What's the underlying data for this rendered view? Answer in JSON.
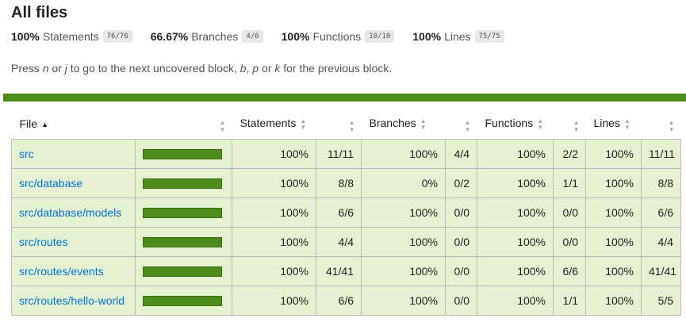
{
  "page": {
    "title": "All files",
    "hint_parts": [
      "Press ",
      "n",
      " or ",
      "j",
      " to go to the next uncovered block, ",
      "b",
      ", ",
      "p",
      " or ",
      "k",
      " for the previous block."
    ]
  },
  "summary": [
    {
      "pct": "100%",
      "label": "Statements",
      "fraction": "76/76"
    },
    {
      "pct": "66.67%",
      "label": "Branches",
      "fraction": "4/6"
    },
    {
      "pct": "100%",
      "label": "Functions",
      "fraction": "10/10"
    },
    {
      "pct": "100%",
      "label": "Lines",
      "fraction": "75/75"
    }
  ],
  "table": {
    "headers": {
      "file": "File",
      "statements": "Statements",
      "branches": "Branches",
      "functions": "Functions",
      "lines": "Lines"
    },
    "rows": [
      {
        "file": "src",
        "coverage": 1.0,
        "stmt_pct": "100%",
        "stmt_frac": "11/11",
        "br_pct": "100%",
        "br_frac": "4/4",
        "br_low": false,
        "fn_pct": "100%",
        "fn_frac": "2/2",
        "ln_pct": "100%",
        "ln_frac": "11/11"
      },
      {
        "file": "src/database",
        "coverage": 1.0,
        "stmt_pct": "100%",
        "stmt_frac": "8/8",
        "br_pct": "0%",
        "br_frac": "0/2",
        "br_low": true,
        "fn_pct": "100%",
        "fn_frac": "1/1",
        "ln_pct": "100%",
        "ln_frac": "8/8"
      },
      {
        "file": "src/database/models",
        "coverage": 1.0,
        "stmt_pct": "100%",
        "stmt_frac": "6/6",
        "br_pct": "100%",
        "br_frac": "0/0",
        "br_low": false,
        "fn_pct": "100%",
        "fn_frac": "0/0",
        "ln_pct": "100%",
        "ln_frac": "6/6"
      },
      {
        "file": "src/routes",
        "coverage": 1.0,
        "stmt_pct": "100%",
        "stmt_frac": "4/4",
        "br_pct": "100%",
        "br_frac": "0/0",
        "br_low": false,
        "fn_pct": "100%",
        "fn_frac": "0/0",
        "ln_pct": "100%",
        "ln_frac": "4/4"
      },
      {
        "file": "src/routes/events",
        "coverage": 1.0,
        "stmt_pct": "100%",
        "stmt_frac": "41/41",
        "br_pct": "100%",
        "br_frac": "0/0",
        "br_low": false,
        "fn_pct": "100%",
        "fn_frac": "6/6",
        "ln_pct": "100%",
        "ln_frac": "41/41"
      },
      {
        "file": "src/routes/hello-world",
        "coverage": 1.0,
        "stmt_pct": "100%",
        "stmt_frac": "6/6",
        "br_pct": "100%",
        "br_frac": "0/0",
        "br_low": false,
        "fn_pct": "100%",
        "fn_frac": "1/1",
        "ln_pct": "100%",
        "ln_frac": "5/5"
      }
    ]
  },
  "colors": {
    "bar": "#4d8b1c",
    "high_bg": "#e5f2d2",
    "low_bg": "#fbdde3",
    "link": "#0074d9"
  }
}
